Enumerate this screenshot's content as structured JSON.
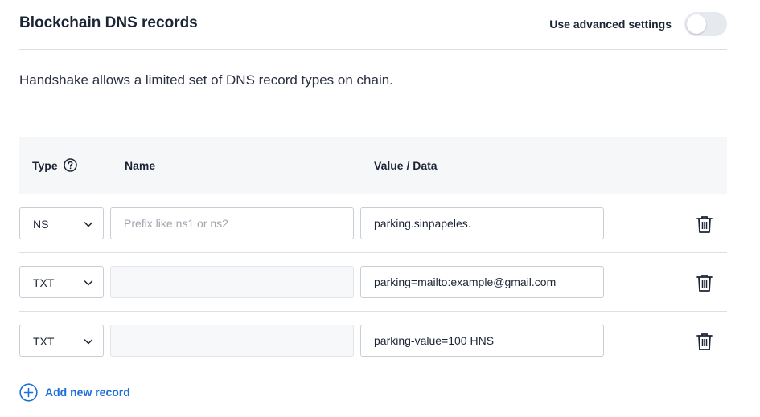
{
  "header": {
    "title": "Blockchain DNS records",
    "advanced_label": "Use advanced settings",
    "advanced_enabled": false
  },
  "description": "Handshake allows a limited set of DNS record types on chain.",
  "table": {
    "columns": {
      "type": "Type",
      "name": "Name",
      "value": "Value / Data"
    },
    "rows": [
      {
        "type": "NS",
        "name": "",
        "name_placeholder": "Prefix like ns1 or ns2",
        "value": "parking.sinpapeles."
      },
      {
        "type": "TXT",
        "name": "",
        "name_placeholder": "",
        "value": "parking=mailto:example@gmail.com"
      },
      {
        "type": "TXT",
        "name": "",
        "name_placeholder": "",
        "value": "parking-value=100 HNS"
      }
    ]
  },
  "add_record_label": "Add new record",
  "colors": {
    "accent": "#1c6ed8",
    "text": "#1c2536",
    "border": "#c9ced6",
    "header_bg": "#f6f7f9"
  }
}
